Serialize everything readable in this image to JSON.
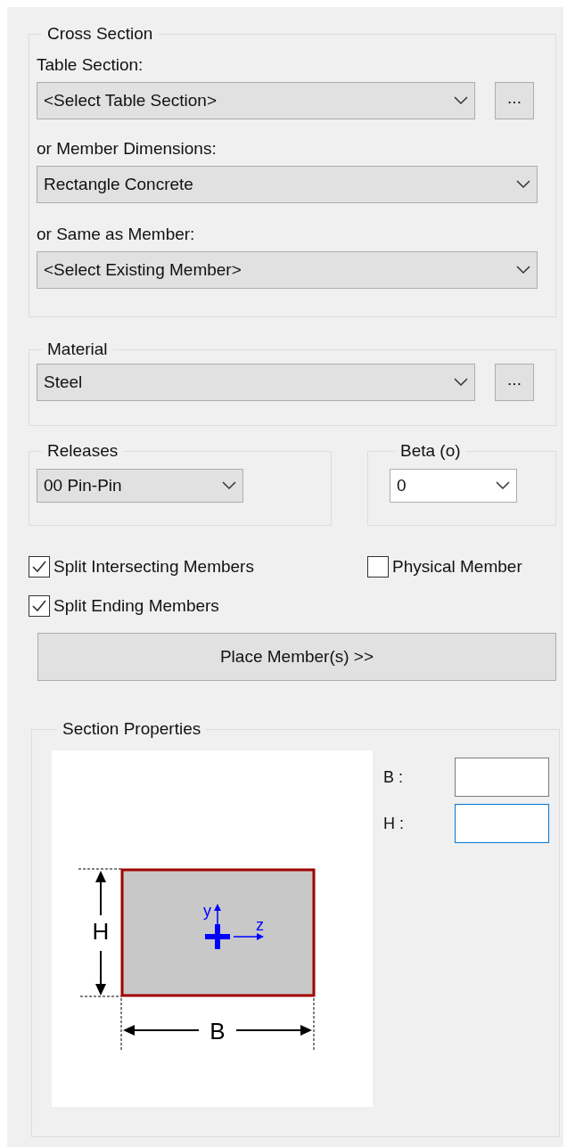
{
  "cross_section": {
    "title": "Cross Section",
    "table_section": {
      "label": "Table Section:",
      "value": "<Select Table Section>",
      "browse": "..."
    },
    "member_dimensions": {
      "label": "or Member Dimensions:",
      "value": "Rectangle Concrete"
    },
    "same_as_member": {
      "label": "or Same as Member:",
      "value": "<Select Existing Member>"
    }
  },
  "material": {
    "title": "Material",
    "value": "Steel",
    "browse": "..."
  },
  "releases": {
    "title": "Releases",
    "value": "00 Pin-Pin"
  },
  "beta": {
    "title": "Beta (o)",
    "value": "0"
  },
  "options": [
    {
      "label": "Split Intersecting Members",
      "checked": true
    },
    {
      "label": "Physical Member",
      "checked": false
    },
    {
      "label": "Split Ending Members",
      "checked": true
    }
  ],
  "place_button": "Place Member(s) >>",
  "section_properties": {
    "title": "Section Properties",
    "diagram": {
      "height_label": "H",
      "width_label": "B",
      "y_axis": "y",
      "z_axis": "z"
    },
    "fields": [
      {
        "label": "B :",
        "focused": false
      },
      {
        "label": "H :",
        "focused": true
      }
    ]
  }
}
